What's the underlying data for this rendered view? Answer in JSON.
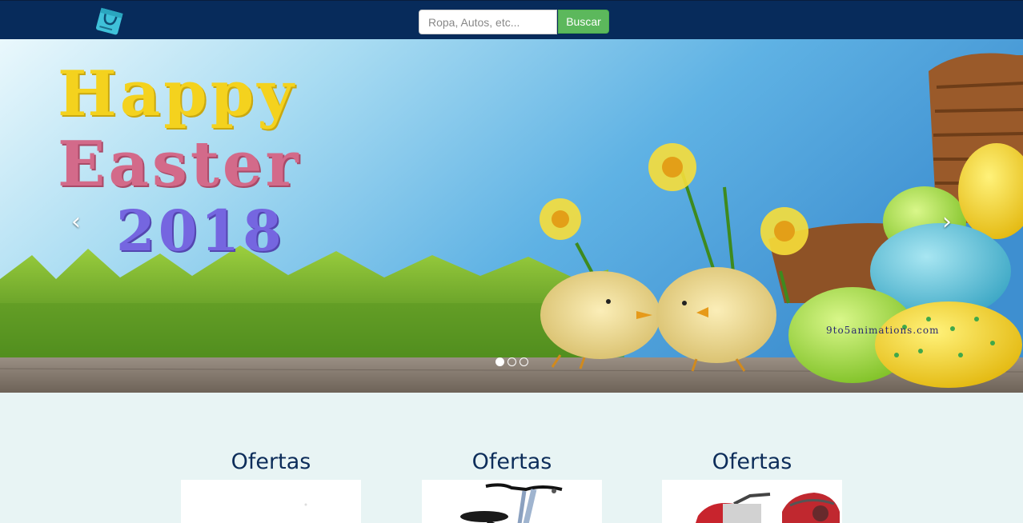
{
  "navbar": {
    "logo_icon": "shopping-bag-icon",
    "search": {
      "placeholder": "Ropa, Autos, etc...",
      "value": "",
      "button_label": "Buscar"
    },
    "colors": {
      "background": "#072b5b",
      "button": "#5cb85c"
    }
  },
  "carousel": {
    "banner_text": [
      "Happy",
      "Easter",
      "2018"
    ],
    "watermark": "9to5animations.com",
    "prev_icon": "chevron-left-icon",
    "next_icon": "chevron-right-icon",
    "slide_count": 3,
    "active_slide": 1
  },
  "offers": [
    {
      "title": "Ofertas",
      "image": "blank-product-image"
    },
    {
      "title": "Ofertas",
      "image": "bicycle-image"
    },
    {
      "title": "Ofertas",
      "image": "stroller-image"
    }
  ]
}
